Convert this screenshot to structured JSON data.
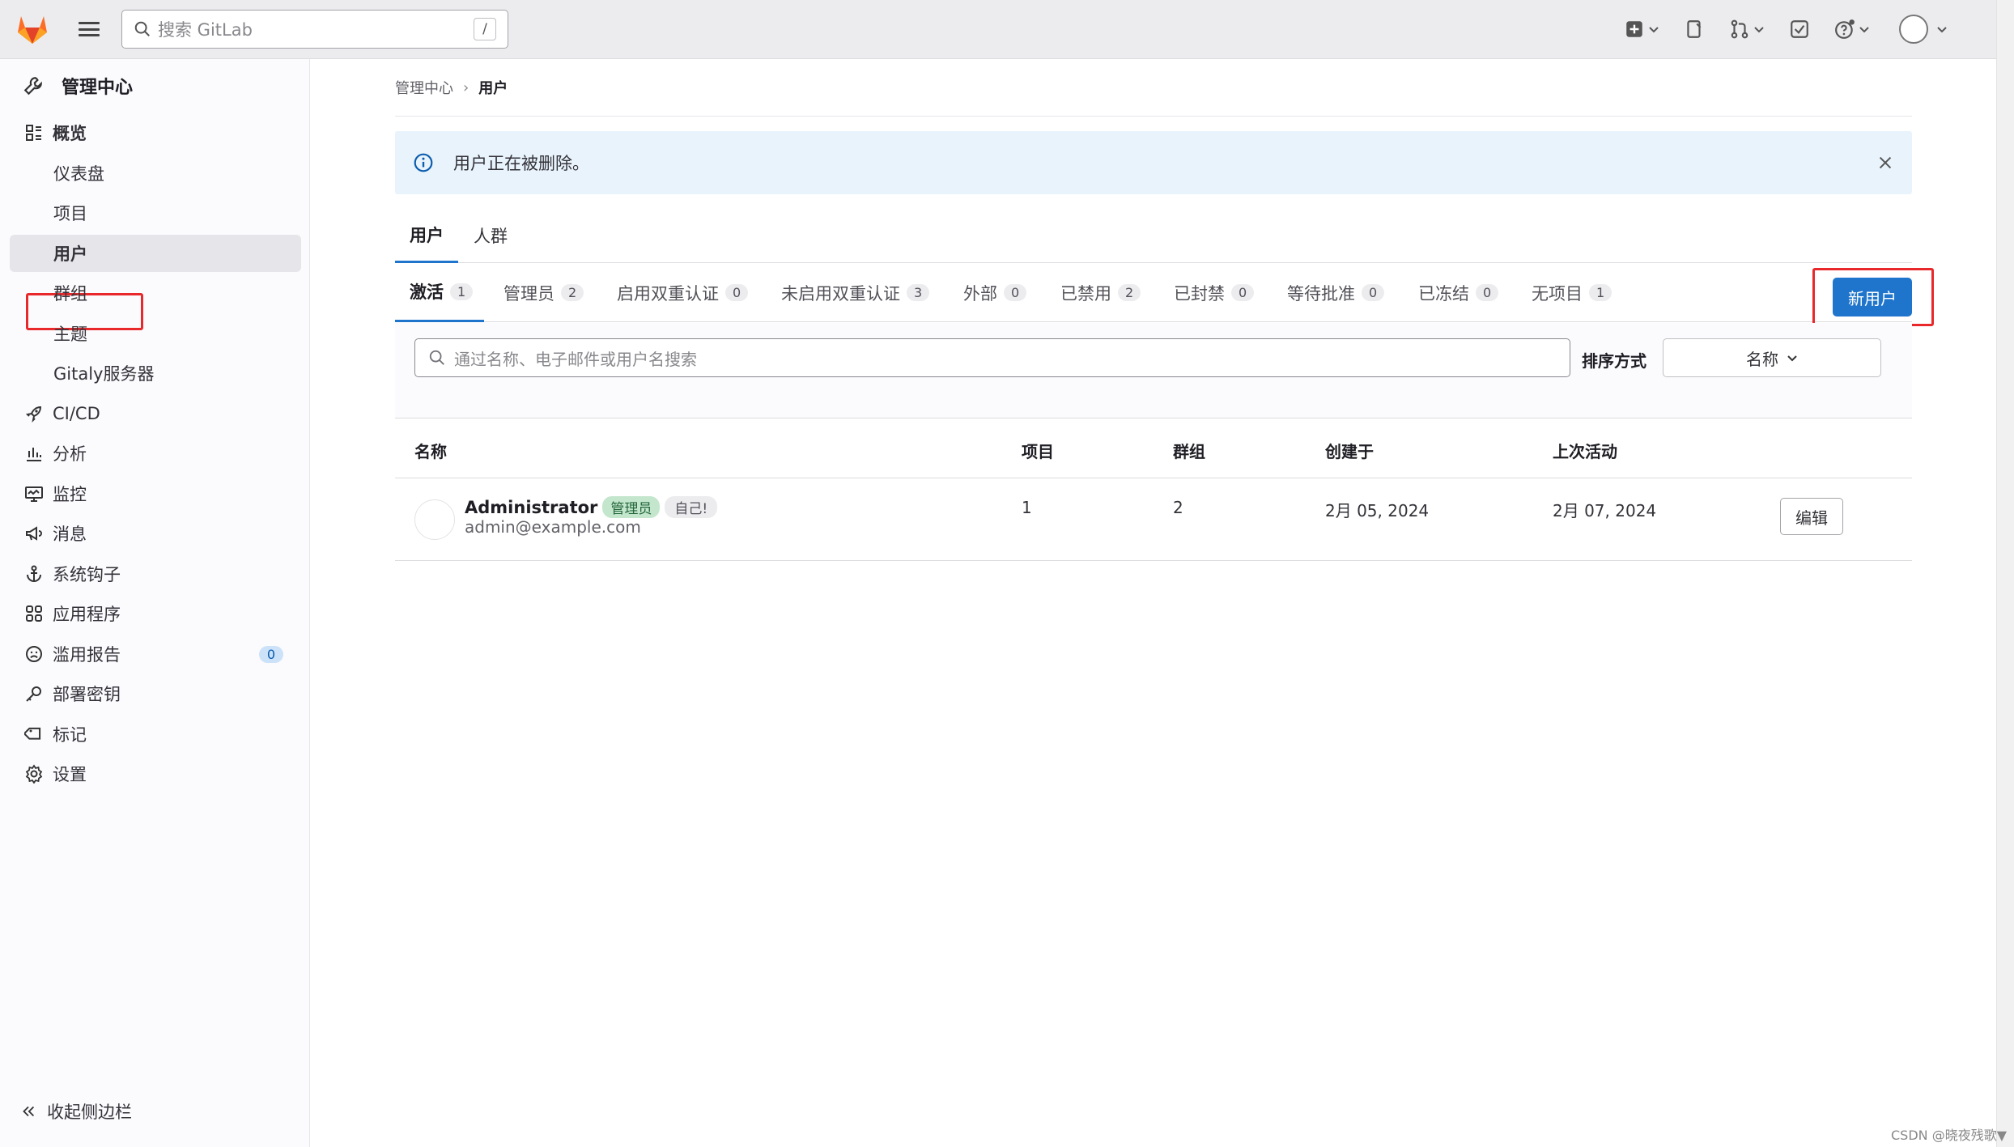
{
  "topbar": {
    "search_placeholder": "搜索 GitLab",
    "search_shortcut": "/",
    "icons": [
      "gitlab-logo",
      "menu-icon",
      "search-icon",
      "plus-square-icon",
      "issues-icon",
      "merge-request-icon",
      "todo-check-icon",
      "help-icon",
      "user-avatar"
    ]
  },
  "sidebar": {
    "title": "管理中心",
    "items": [
      {
        "label": "概览",
        "icon": "overview-icon"
      },
      {
        "label": "仪表盘"
      },
      {
        "label": "项目"
      },
      {
        "label": "用户"
      },
      {
        "label": "群组"
      },
      {
        "label": "主题"
      },
      {
        "label": "Gitaly服务器"
      },
      {
        "label": "CI/CD",
        "icon": "rocket-icon"
      },
      {
        "label": "分析",
        "icon": "chart-icon"
      },
      {
        "label": "监控",
        "icon": "monitor-icon"
      },
      {
        "label": "消息",
        "icon": "bullhorn-icon"
      },
      {
        "label": "系统钩子",
        "icon": "anchor-icon"
      },
      {
        "label": "应用程序",
        "icon": "apps-icon"
      },
      {
        "label": "滥用报告",
        "icon": "abuse-icon",
        "badge": "0"
      },
      {
        "label": "部署密钥",
        "icon": "key-icon"
      },
      {
        "label": "标记",
        "icon": "label-icon"
      },
      {
        "label": "设置",
        "icon": "settings-icon"
      }
    ],
    "collapse_label": "收起侧边栏"
  },
  "breadcrumb": {
    "parent": "管理中心",
    "sep": "›",
    "current": "用户"
  },
  "alert": {
    "text": "用户正在被删除。"
  },
  "tabs_top": [
    {
      "label": "用户"
    },
    {
      "label": "人群"
    }
  ],
  "tabs_filter": [
    {
      "label": "激活",
      "count": "1"
    },
    {
      "label": "管理员",
      "count": "2"
    },
    {
      "label": "启用双重认证",
      "count": "0"
    },
    {
      "label": "未启用双重认证",
      "count": "3"
    },
    {
      "label": "外部",
      "count": "0"
    },
    {
      "label": "已禁用",
      "count": "2"
    },
    {
      "label": "已封禁",
      "count": "0"
    },
    {
      "label": "等待批准",
      "count": "0"
    },
    {
      "label": "已冻结",
      "count": "0"
    },
    {
      "label": "无项目",
      "count": "1"
    }
  ],
  "new_user_label": "新用户",
  "filter": {
    "search_placeholder": "通过名称、电子邮件或用户名搜索",
    "sort_label": "排序方式",
    "sort_value": "名称"
  },
  "table": {
    "headers": [
      "名称",
      "项目",
      "群组",
      "创建于",
      "上次活动"
    ],
    "rows": [
      {
        "name": "Administrator",
        "badge_admin": "管理员",
        "badge_self": "自己!",
        "email": "admin@example.com",
        "projects": "1",
        "groups": "2",
        "created": "2月 05, 2024",
        "last_activity": "2月 07, 2024",
        "edit_label": "编辑"
      }
    ]
  },
  "watermark": "CSDN @晓夜残歌▼",
  "colors": {
    "primary": "#1f75cb",
    "highlight": "#e8282b",
    "alert_bg": "#e9f3fc"
  }
}
